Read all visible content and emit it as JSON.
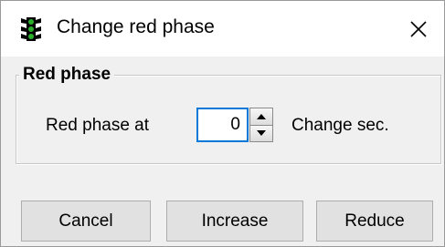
{
  "window": {
    "title": "Change red phase",
    "icon": "traffic-light-icon",
    "close_icon": "close-icon"
  },
  "group": {
    "legend": "Red phase",
    "row_label": "Red phase at",
    "value": "0",
    "suffix": "Change sec."
  },
  "buttons": {
    "cancel": "Cancel",
    "increase": "Increase",
    "reduce": "Reduce"
  },
  "colors": {
    "focus_border": "#0078d7",
    "traffic_light_body": "#000000",
    "traffic_light_lamps": "#2bb02b"
  }
}
